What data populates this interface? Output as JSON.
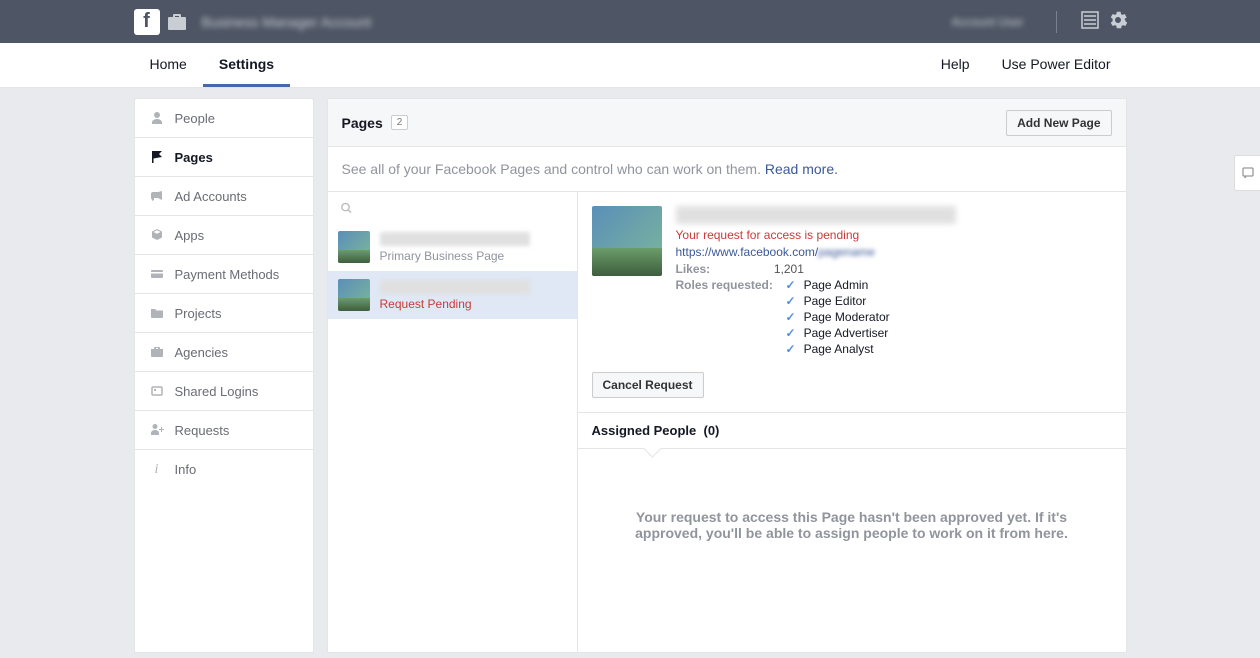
{
  "topbar": {
    "title": "Business Manager Account",
    "user": "Account User"
  },
  "nav": {
    "home": "Home",
    "settings": "Settings",
    "help": "Help",
    "power_editor": "Use Power Editor"
  },
  "sidebar": {
    "items": [
      {
        "label": "People"
      },
      {
        "label": "Pages"
      },
      {
        "label": "Ad Accounts"
      },
      {
        "label": "Apps"
      },
      {
        "label": "Payment Methods"
      },
      {
        "label": "Projects"
      },
      {
        "label": "Agencies"
      },
      {
        "label": "Shared Logins"
      },
      {
        "label": "Requests"
      },
      {
        "label": "Info"
      }
    ]
  },
  "main": {
    "title": "Pages",
    "count": "2",
    "add_btn": "Add New Page",
    "desc": "See all of your Facebook Pages and control who can work on them. ",
    "read_more": "Read more."
  },
  "pages": [
    {
      "sub": "Primary Business Page"
    },
    {
      "sub": "Request Pending"
    }
  ],
  "detail": {
    "pending": "Your request for access is pending",
    "url_prefix": "https://www.facebook.com/",
    "likes_label": "Likes:",
    "likes_value": "1,201",
    "roles_label": "Roles requested:",
    "roles": [
      "Page Admin",
      "Page Editor",
      "Page Moderator",
      "Page Advertiser",
      "Page Analyst"
    ],
    "cancel_btn": "Cancel Request",
    "assigned_title": "Assigned People",
    "assigned_count": "(0)",
    "assigned_msg": "Your request to access this Page hasn't been approved yet. If it's approved, you'll be able to assign people to work on it from here."
  }
}
